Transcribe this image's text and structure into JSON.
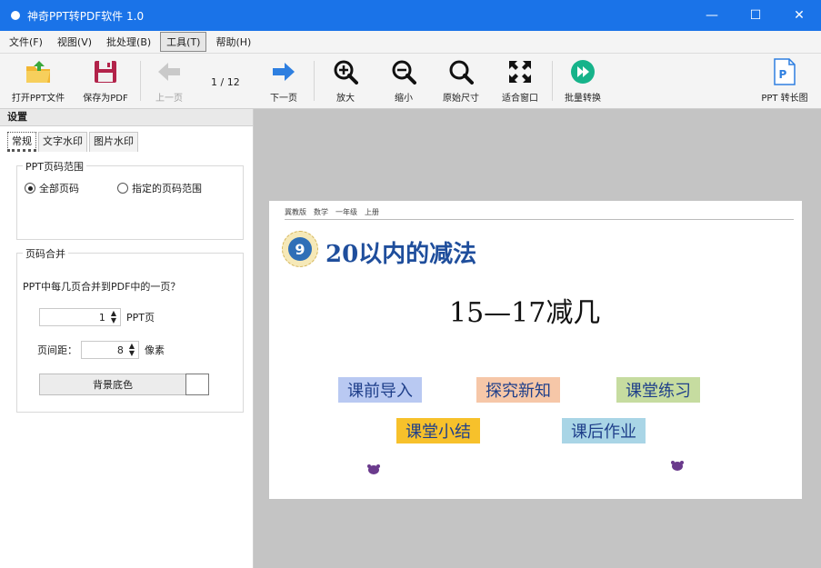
{
  "window": {
    "title": "神奇PPT转PDF软件 1.0",
    "controls": {
      "minimize": "—",
      "maximize": "☐",
      "close": "✕"
    }
  },
  "menu": [
    "文件(F)",
    "视图(V)",
    "批处理(B)",
    "工具(T)",
    "帮助(H)"
  ],
  "toolbar": {
    "open": "打开PPT文件",
    "save": "保存为PDF",
    "prev": "上一页",
    "page_counter": "1 / 12",
    "next": "下一页",
    "zoom_in": "放大",
    "zoom_out": "缩小",
    "actual_size": "原始尺寸",
    "fit_window": "适合窗口",
    "batch": "批量转换",
    "long_image": "PPT 转长图"
  },
  "panel": {
    "header": "设置",
    "tabs": [
      "常规",
      "文字水印",
      "图片水印"
    ],
    "range": {
      "legend": "PPT页码范围",
      "all_pages": "全部页码",
      "specified": "指定的页码范围"
    },
    "merge": {
      "legend": "页码合并",
      "question": "PPT中每几页合并到PDF中的一页？",
      "pages_value": "1",
      "pages_unit": "PPT页",
      "spacing_label": "页间距：",
      "spacing_value": "8",
      "spacing_unit": "像素",
      "bg_button": "背景底色"
    }
  },
  "slide": {
    "header": "冀教版　数学　一年级　上册",
    "badge": "9",
    "lesson_title": "20以内的减法",
    "big_title": "15—17减几",
    "chips": [
      {
        "label": "课前导入",
        "color": "#b9c9f2"
      },
      {
        "label": "探究新知",
        "color": "#f6c7a8"
      },
      {
        "label": "课堂练习",
        "color": "#c6dca0"
      },
      {
        "label": "课堂小结",
        "color": "#f7c12b"
      },
      {
        "label": "课后作业",
        "color": "#a9d5e6"
      }
    ]
  },
  "colors": {
    "titlebar": "#1a73e8",
    "accent_blue": "#2e7fe0",
    "batch_green": "#16b38a"
  }
}
